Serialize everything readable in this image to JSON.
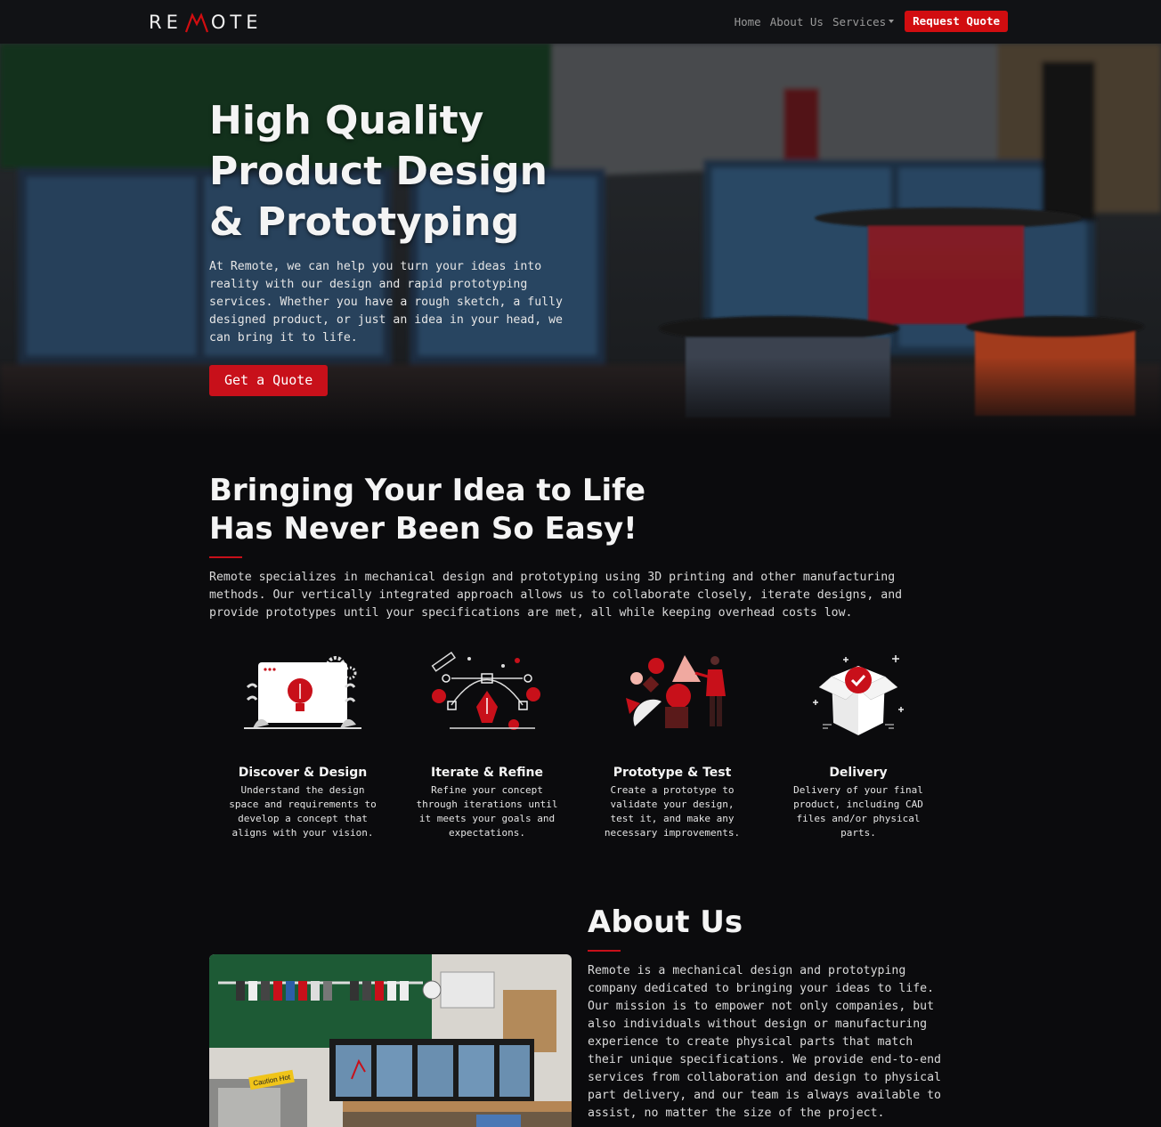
{
  "nav": {
    "logo_text": "REMOTE",
    "links": [
      "Home",
      "About Us",
      "Services"
    ],
    "cta": "Request Quote"
  },
  "hero": {
    "title_line1": "High Quality",
    "title_line2": "Product Design",
    "title_line3": "& Prototyping",
    "text": "At Remote, we can help you turn your ideas into reality with our design and rapid prototyping services. Whether you have a rough sketch, a fully designed product, or just an idea in your head, we can bring it to life.",
    "button": "Get a Quote"
  },
  "process": {
    "title_line1": "Bringing Your Idea to Life",
    "title_line2": "Has Never Been So Easy!",
    "text": "Remote specializes in mechanical design and prototyping using 3D printing and other manufacturing methods. Our vertically integrated approach allows us to collaborate closely, iterate designs, and provide prototypes until your specifications are met, all while keeping overhead costs low.",
    "steps": [
      {
        "title": "Discover & Design",
        "text": "Understand the design space and requirements to develop a concept that aligns with your vision.",
        "icon": "lightbulb-icon"
      },
      {
        "title": "Iterate & Refine",
        "text": "Refine your concept through iterations until it meets your goals and expectations.",
        "icon": "pen-tool-icon"
      },
      {
        "title": "Prototype & Test",
        "text": "Create a prototype to validate your design, test it, and make any necessary improvements.",
        "icon": "shapes-icon"
      },
      {
        "title": "Delivery",
        "text": "Delivery of your final product, including CAD files and/or physical parts.",
        "icon": "box-icon"
      }
    ]
  },
  "about": {
    "title": "About Us",
    "text": "Remote is a mechanical design and prototyping company dedicated to bringing your ideas to life. Our mission is to empower not only companies, but also individuals without design or manufacturing experience to create physical parts that match their unique specifications. We provide end-to-end services from collaboration and design to physical part delivery, and our team is always available to assist, no matter the size of the project.",
    "sign_text": "Caution Hot"
  },
  "colors": {
    "accent": "#c8101a",
    "background": "#0b0b0d",
    "navbar": "#111215"
  }
}
